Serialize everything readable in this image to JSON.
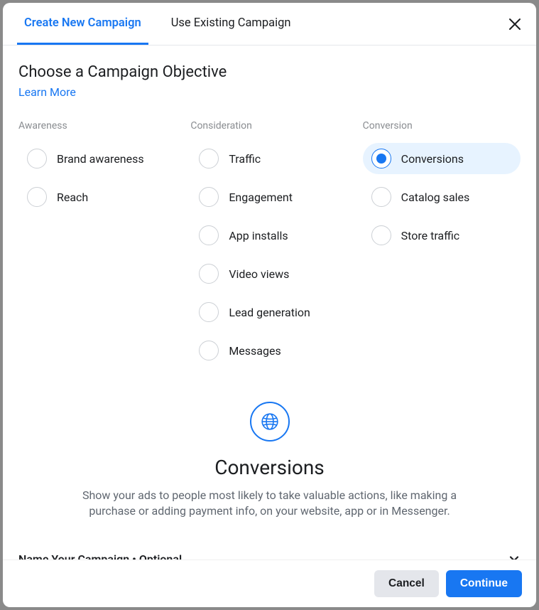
{
  "tabs": {
    "create": "Create New Campaign",
    "existing": "Use Existing Campaign"
  },
  "heading": "Choose a Campaign Objective",
  "learn_more": "Learn More",
  "columns": {
    "awareness": {
      "title": "Awareness",
      "items": [
        {
          "label": "Brand awareness",
          "selected": false
        },
        {
          "label": "Reach",
          "selected": false
        }
      ]
    },
    "consideration": {
      "title": "Consideration",
      "items": [
        {
          "label": "Traffic",
          "selected": false
        },
        {
          "label": "Engagement",
          "selected": false
        },
        {
          "label": "App installs",
          "selected": false
        },
        {
          "label": "Video views",
          "selected": false
        },
        {
          "label": "Lead generation",
          "selected": false
        },
        {
          "label": "Messages",
          "selected": false
        }
      ]
    },
    "conversion": {
      "title": "Conversion",
      "items": [
        {
          "label": "Conversions",
          "selected": true
        },
        {
          "label": "Catalog sales",
          "selected": false
        },
        {
          "label": "Store traffic",
          "selected": false
        }
      ]
    }
  },
  "detail": {
    "title": "Conversions",
    "description": "Show your ads to people most likely to take valuable actions, like making a purchase or adding payment info, on your website, app or in Messenger."
  },
  "name_section": "Name Your Campaign • Optional",
  "footer": {
    "cancel": "Cancel",
    "continue": "Continue"
  }
}
